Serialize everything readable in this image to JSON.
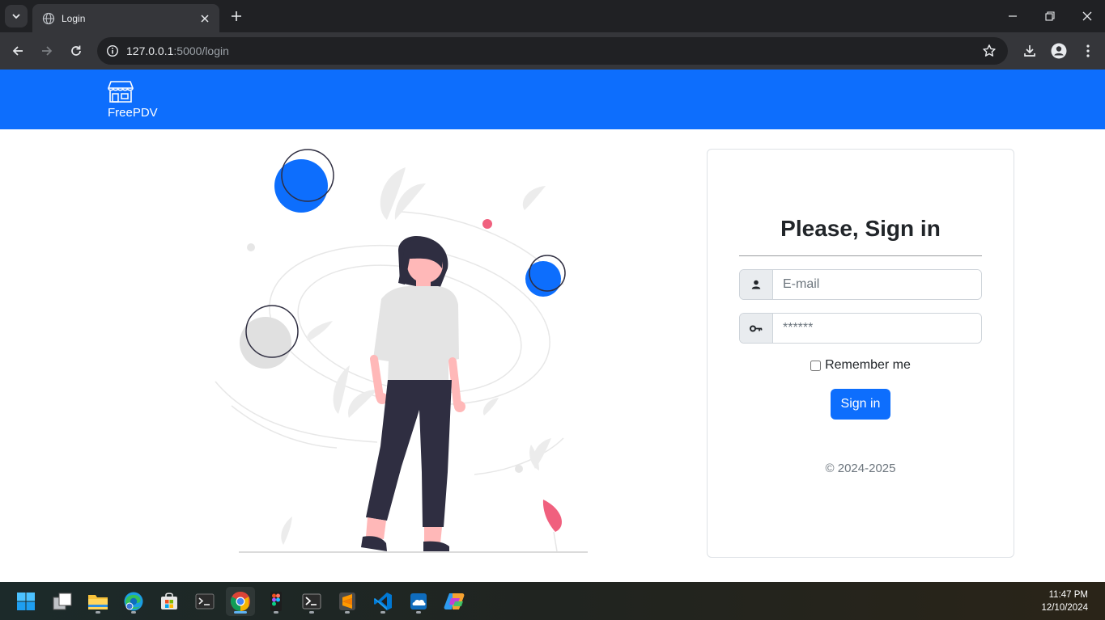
{
  "browser": {
    "tab_title": "Login",
    "url_host": "127.0.0.1",
    "url_rest": ":5000/login"
  },
  "app": {
    "brand_name": "FreePDV",
    "brand_color": "#0d6efd"
  },
  "login": {
    "heading": "Please, Sign in",
    "email_placeholder": "E-mail",
    "password_placeholder": "******",
    "remember_label": "Remember me",
    "submit_label": "Sign in",
    "copyright": "© 2024-2025"
  },
  "taskbar": {
    "icons": [
      "windows-start-icon",
      "task-view-icon",
      "file-explorer-icon",
      "edge-icon",
      "store-icon",
      "terminal-icon",
      "chrome-icon",
      "figma-icon",
      "powershell-icon",
      "sublime-text-icon",
      "vscode-icon",
      "onedrive-icon",
      "copilot-icon"
    ],
    "time": "11:47 PM",
    "date": "12/10/2024"
  }
}
